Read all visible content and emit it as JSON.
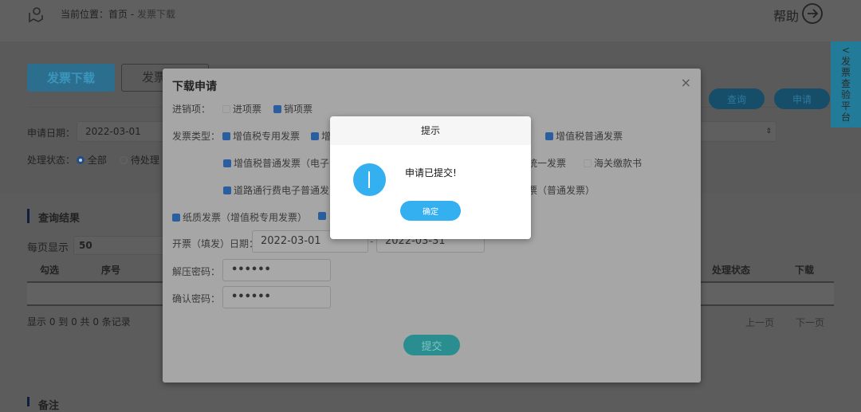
{
  "header": {
    "location_label": "当前位置：",
    "crumb_home": "首页",
    "crumb_sep": "-",
    "crumb_current": "发票下载",
    "help": "帮助"
  },
  "tabs": {
    "download": "发票下载",
    "other": "发票"
  },
  "filters": {
    "apply_date_label": "申请日期：",
    "apply_date_start": "2022-03-01",
    "status_label": "处理状态：",
    "status_all": "全部",
    "status_pending": "待处理",
    "query": "查询",
    "apply": "申请"
  },
  "side_panel": {
    "label": [
      "发",
      "票",
      "查",
      "验",
      "平",
      "台"
    ]
  },
  "results": {
    "title": "查询结果",
    "per_page_label": "每页显示",
    "per_page": "50",
    "columns": {
      "select": "勾选",
      "index": "序号",
      "status": "处理状态",
      "download": "下载"
    },
    "summary": "显示 0 到 0 共 0 条记录",
    "prev": "上一页",
    "next": "下一页",
    "remarks_title": "备注"
  },
  "modal": {
    "title": "下载申请",
    "direction_label": "进销项：",
    "direction": [
      {
        "label": "进项票",
        "checked": false
      },
      {
        "label": "销项票",
        "checked": true
      }
    ],
    "type_label": "发票类型：",
    "types_row1": [
      {
        "label": "增值税专用发票",
        "checked": true
      },
      {
        "label": "增",
        "checked": true
      },
      {
        "label": "增值税普通发票",
        "checked": true
      }
    ],
    "types_row2": [
      {
        "label": "增值税普通发票（电子",
        "checked": true
      },
      {
        "label": "统一发票",
        "checked": true
      },
      {
        "label": "海关缴款书",
        "checked": false
      }
    ],
    "types_row3": [
      {
        "label": "道路通行费电子普通发",
        "checked": true
      },
      {
        "label": "票（普通发票）"
      }
    ],
    "types_row4": [
      {
        "label": "纸质发票（增值税专用发票）",
        "checked": true
      },
      {
        "label": "",
        "checked": true
      }
    ],
    "date_label": "开票（填发）日期：",
    "date_start": "2022-03-01",
    "date_sep": "-",
    "date_end": "2022-03-31",
    "pwd_label": "解压密码：",
    "pwd": "••••••",
    "confirm_label": "确认密码：",
    "confirm": "••••••",
    "submit": "提交"
  },
  "alert": {
    "title": "提示",
    "message": "申请已提交!",
    "ok": "确定"
  }
}
